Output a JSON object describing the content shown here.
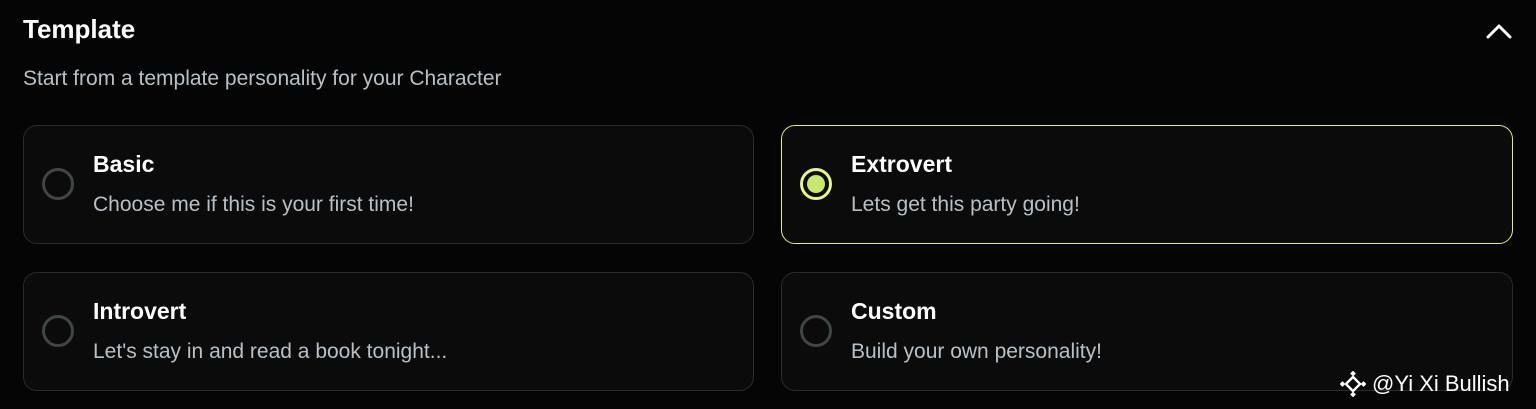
{
  "section": {
    "title": "Template",
    "subtitle": "Start from a template personality for your Character",
    "collapse_icon": "chevron-up-icon"
  },
  "options": [
    {
      "title": "Basic",
      "description": "Choose me if this is your first time!",
      "selected": false
    },
    {
      "title": "Extrovert",
      "description": "Lets get this party going!",
      "selected": true
    },
    {
      "title": "Introvert",
      "description": "Let's stay in and read a book tonight...",
      "selected": false
    },
    {
      "title": "Custom",
      "description": "Build your own personality!",
      "selected": false
    }
  ],
  "colors": {
    "background": "#050505",
    "card_background": "#0b0b0b",
    "card_border": "#2a2b2d",
    "accent": "#dbf27a",
    "radio_fill": "#c8e86a",
    "muted_text": "#b8c0c7"
  },
  "watermark": {
    "text": "@Yi Xi Bullish",
    "icon": "binance-logo-icon"
  }
}
